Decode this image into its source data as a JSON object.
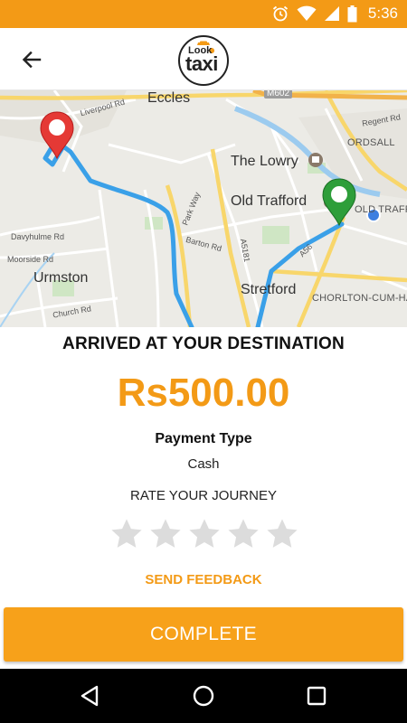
{
  "status_bar": {
    "time": "5:36",
    "icons": [
      "alarm-icon",
      "wifi-icon",
      "signal-icon",
      "battery-icon"
    ]
  },
  "app_bar": {
    "logo_top": "Look",
    "logo_main": "taxi",
    "back_icon": "arrow-left-icon"
  },
  "map": {
    "places": {
      "eccles": "Eccles",
      "the_lowry": "The Lowry",
      "old_trafford": "Old Trafford",
      "urmston": "Urmston",
      "stretford": "Stretford",
      "ordsall": "ORDSALL",
      "old_traff_edge": "OLD TRAFF",
      "chorlton": "CHORLTON-CUM-HA"
    },
    "roads": {
      "liverpool_rd": "Liverpool Rd",
      "regent_rd": "Regent Rd",
      "park_way": "Park Way",
      "barton_rd": "Barton Rd",
      "a5181": "A5181",
      "davyhulme_rd": "Davyhulme Rd",
      "moorside_rd": "Moorside Rd",
      "church_rd": "Church Rd",
      "a56": "A56",
      "m602": "M602"
    },
    "colors": {
      "route": "#3aa0e8",
      "origin_pin": "#e53935",
      "destination_pin": "#2e9e3a",
      "current_location": "#3d7fe0"
    }
  },
  "trip": {
    "status": "ARRIVED AT YOUR DESTINATION",
    "fare": "Rs500.00",
    "payment_type_label": "Payment Type",
    "payment_type_value": "Cash",
    "rate_label": "RATE YOUR JOURNEY",
    "rating": 0,
    "max_rating": 5,
    "feedback_label": "SEND FEEDBACK"
  },
  "actions": {
    "complete_label": "COMPLETE"
  },
  "nav_bar": {
    "icons": [
      "back-triangle-icon",
      "home-circle-icon",
      "recents-square-icon"
    ]
  },
  "theme": {
    "accent": "#f39a16"
  }
}
